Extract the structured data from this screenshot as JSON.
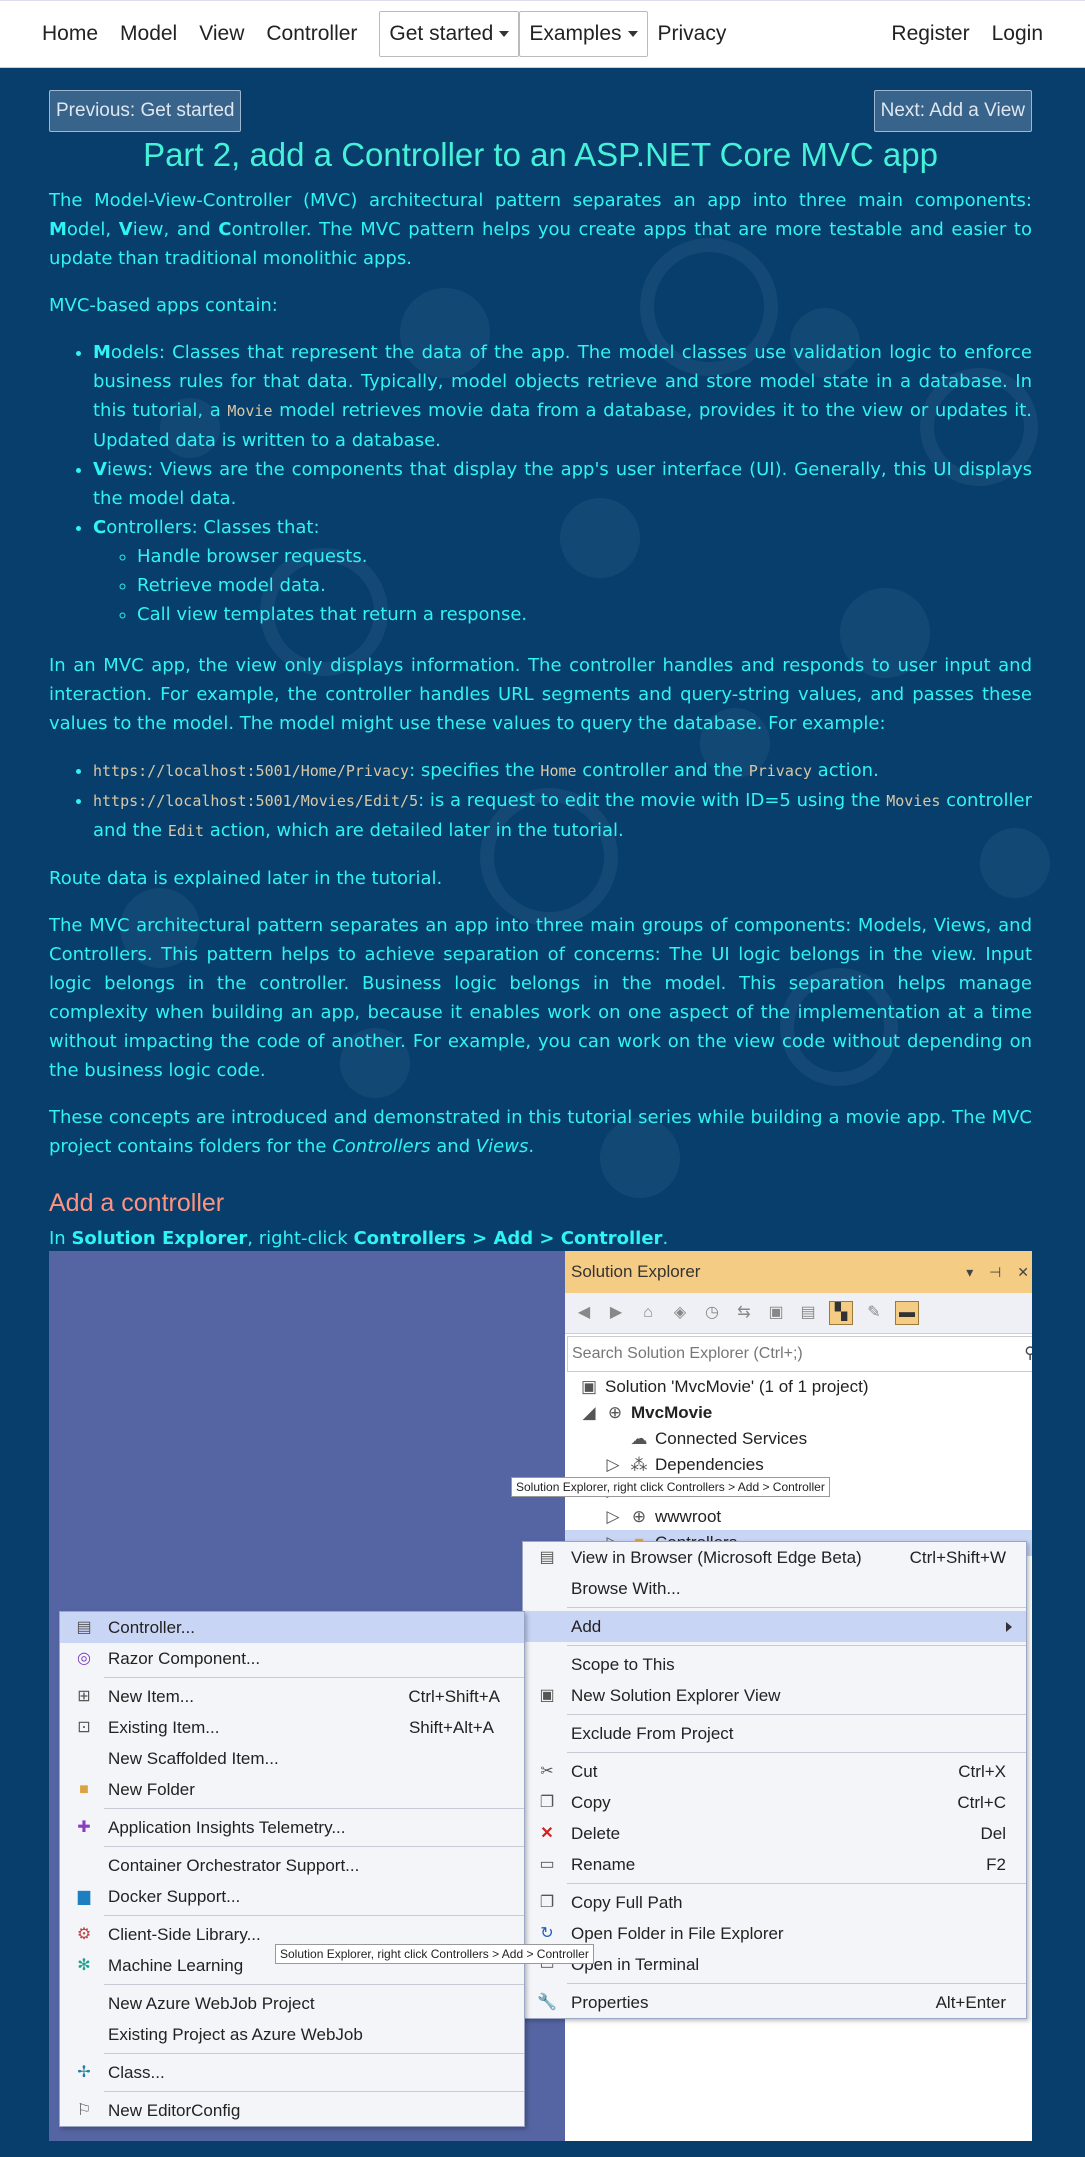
{
  "nav": {
    "home": "Home",
    "model": "Model",
    "view": "View",
    "controller": "Controller",
    "get_started": "Get started",
    "examples": "Examples",
    "privacy": "Privacy",
    "register": "Register",
    "login": "Login"
  },
  "pager": {
    "prev": "Previous: Get started",
    "next": "Next: Add a View"
  },
  "title": "Part 2, add a Controller to an ASP.NET Core MVC app",
  "intro": {
    "p1_a": "The Model-View-Controller (MVC) architectural pattern separates an app into three main components: ",
    "m": "M",
    "odel": "odel, ",
    "v": "V",
    "iew": "iew, and ",
    "c": "C",
    "ontroller": "ontroller. ",
    "p1_b": "The MVC pattern helps you create apps that are more testable and easier to update than traditional monolithic apps.",
    "p2": "MVC-based apps contain:"
  },
  "models_item": {
    "m": "M",
    "rest_a": "odels: Classes that represent the data of the app. The model classes use validation logic to enforce business rules for that data. Typically, model objects retrieve and store model state in a database. In this tutorial, a ",
    "code": "Movie",
    "rest_b": " model retrieves movie data from a database, provides it to the view or updates it. Updated data is written to a database."
  },
  "views_item": {
    "v": "V",
    "rest": "iews: Views are the components that display the app's user interface (UI). Generally, this UI displays the model data."
  },
  "controllers_item": {
    "c": "C",
    "rest": "ontrollers: Classes that:",
    "subs": [
      "Handle browser requests.",
      "Retrieve model data.",
      "Call view templates that return a response."
    ]
  },
  "p3": "In an MVC app, the view only displays information. The controller handles and responds to user input and interaction. For example, the controller handles URL segments and query-string values, and passes these values to the model. The model might use these values to query the database. For example:",
  "url1": {
    "code": "https://localhost:5001/Home/Privacy",
    "a": ": specifies the ",
    "home": "Home",
    "b": " controller and the ",
    "privacy": "Privacy",
    "c": " action."
  },
  "url2": {
    "code": "https://localhost:5001/Movies/Edit/5",
    "a": ": is a request to edit the movie with ID=5 using the ",
    "movies": "Movies",
    "b": " controller and the ",
    "edit": "Edit",
    "c": " action, which are detailed later in the tutorial."
  },
  "p4": "Route data is explained later in the tutorial.",
  "p5": "The MVC architectural pattern separates an app into three main groups of components: Models, Views, and Controllers. This pattern helps to achieve separation of concerns: The UI logic belongs in the view. Input logic belongs in the controller. Business logic belongs in the model. This separation helps manage complexity when building an app, because it enables work on one aspect of the implementation at a time without impacting the code of another. For example, you can work on the view code without depending on the business logic code.",
  "p6": {
    "a": "These concepts are introduced and demonstrated in this tutorial series while building a movie app. The MVC project contains folders for the ",
    "controllers": "Controllers",
    "and": " and ",
    "views": "Views",
    "end": "."
  },
  "h2": "Add a controller",
  "instr": {
    "in": "In ",
    "se": "Solution Explorer",
    "rc": ", right-click ",
    "path": "Controllers > Add > Controller",
    "end": "."
  },
  "screenshot": {
    "se_title": "Solution Explorer",
    "search_placeholder": "Search Solution Explorer (Ctrl+;)",
    "tree": {
      "solution": "Solution 'MvcMovie' (1 of 1 project)",
      "project": "MvcMovie",
      "connected": "Connected Services",
      "deps": "Dependencies",
      "wwwroot": "wwwroot",
      "controllers": "Controllers"
    },
    "tooltip": "Solution Explorer, right click Controllers > Add > Controller",
    "ctx": {
      "view_browser": "View in Browser (Microsoft Edge Beta)",
      "view_browser_sc": "Ctrl+Shift+W",
      "browse_with": "Browse With...",
      "add": "Add",
      "scope": "Scope to This",
      "new_se_view": "New Solution Explorer View",
      "exclude": "Exclude From Project",
      "cut": "Cut",
      "cut_sc": "Ctrl+X",
      "copy": "Copy",
      "copy_sc": "Ctrl+C",
      "delete": "Delete",
      "delete_sc": "Del",
      "rename": "Rename",
      "rename_sc": "F2",
      "copy_path": "Copy Full Path",
      "open_folder": "Open Folder in File Explorer",
      "open_terminal": "Open in Terminal",
      "properties": "Properties",
      "properties_sc": "Alt+Enter"
    },
    "sub": {
      "controller": "Controller...",
      "razor": "Razor Component...",
      "new_item": "New Item...",
      "new_item_sc": "Ctrl+Shift+A",
      "existing_item": "Existing Item...",
      "existing_item_sc": "Shift+Alt+A",
      "scaffolded": "New Scaffolded Item...",
      "new_folder": "New Folder",
      "insights": "Application Insights Telemetry...",
      "orchestrator": "Container Orchestrator Support...",
      "docker": "Docker Support...",
      "client_lib": "Client-Side Library...",
      "ml": "Machine Learning",
      "webjob": "New Azure WebJob Project",
      "existing_webjob": "Existing Project as Azure WebJob",
      "class": "Class...",
      "editorconfig": "New EditorConfig"
    }
  },
  "colors": {
    "bg": "#073e6b",
    "text": "#2ff3f5",
    "heading": "#45f1d9",
    "h2": "#ff9380",
    "se_title": "#f5cc84",
    "menu_highlight": "#c9d5f5"
  }
}
